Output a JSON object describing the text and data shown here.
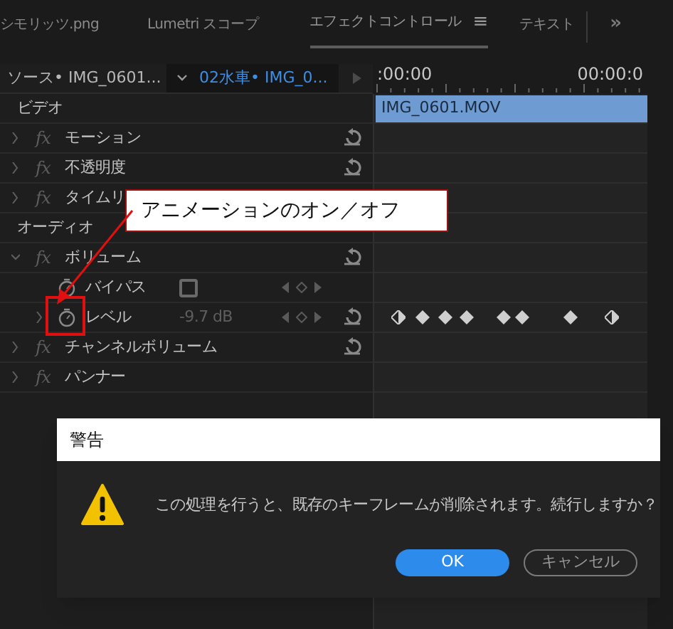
{
  "tabs": [
    {
      "label": "シモリッツ.png",
      "selected": false
    },
    {
      "label": "Lumetri スコープ",
      "selected": false
    },
    {
      "label": "エフェクトコントロール",
      "selected": true,
      "menu_glyph": "≡"
    },
    {
      "label": "テキスト",
      "selected": false
    }
  ],
  "overflow_glyph": "»",
  "source": {
    "label": "ソース• IMG_0601...",
    "sequence": "02水車• IMG_0..."
  },
  "timeline": {
    "start_time": ":00:00",
    "end_time": "00:00:0",
    "clip": "IMG_0601.MOV"
  },
  "effects": [
    {
      "kind": "section",
      "label": "ビデオ"
    },
    {
      "kind": "effect",
      "label": "モーション",
      "badge": "fx",
      "expanded": false,
      "reset": true
    },
    {
      "kind": "effect",
      "label": "不透明度",
      "badge": "fx",
      "expanded": false,
      "reset": true
    },
    {
      "kind": "effect",
      "label": "タイムリ",
      "badge": "fx",
      "expanded": false
    },
    {
      "kind": "section",
      "label": "オーディオ"
    },
    {
      "kind": "effect",
      "label": "ボリューム",
      "badge": "fx",
      "expanded": true,
      "reset": true
    },
    {
      "kind": "param",
      "label": "バイパス",
      "checked": false,
      "expandable": false,
      "animated": false,
      "reset": false
    },
    {
      "kind": "param",
      "label": "レベル",
      "value": "-9.7 dB",
      "expandable": true,
      "animated": false,
      "reset": true,
      "keyframes": [
        {
          "kind": "half"
        },
        {
          "kind": "full"
        },
        {
          "kind": "full"
        },
        {
          "kind": "full"
        },
        {
          "kind": "full"
        },
        {
          "kind": "full"
        },
        {
          "kind": "full"
        },
        {
          "kind": "half"
        }
      ]
    },
    {
      "kind": "effect",
      "label": "チャンネルボリューム",
      "badge": "fx",
      "expanded": false,
      "reset": true
    },
    {
      "kind": "effect",
      "label": "パンナー",
      "badge": "fx",
      "expanded": false,
      "reset": false
    }
  ],
  "callout": {
    "text": "アニメーションのオン／オフ"
  },
  "dialog": {
    "title": "警告",
    "message": "この処理を行うと、既存のキーフレームが削除されます。続行しますか？",
    "buttons": [
      {
        "label": "OK",
        "primary": true
      },
      {
        "label": "キャンセル",
        "primary": false
      }
    ]
  }
}
